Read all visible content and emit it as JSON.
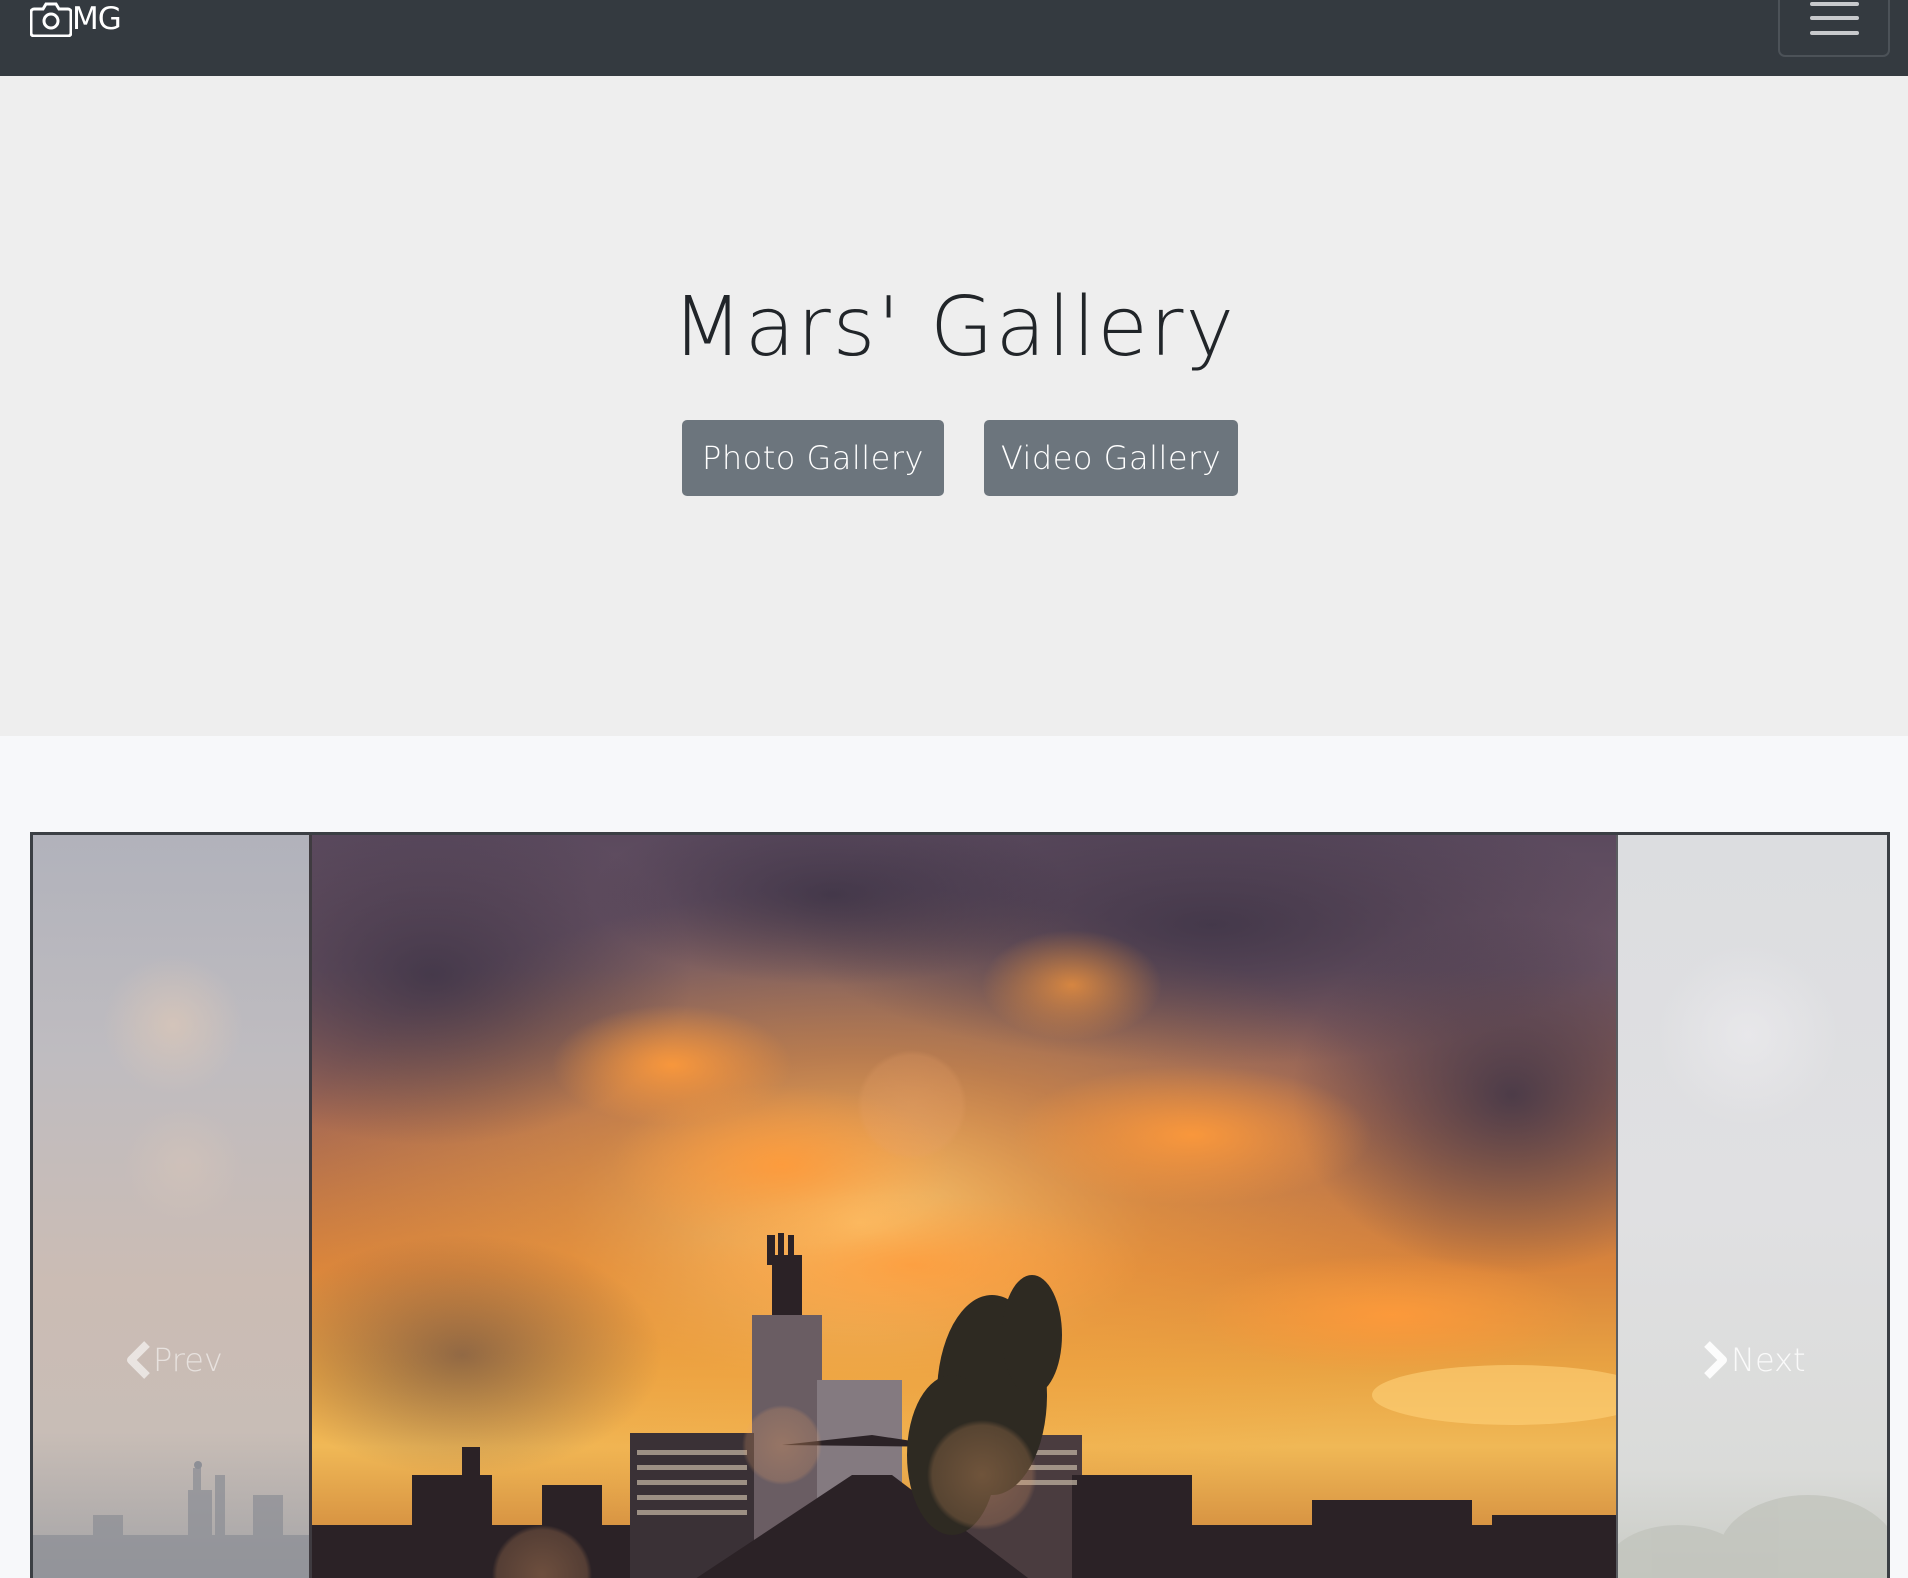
{
  "navbar": {
    "brand_text": "MG",
    "brand_icon": "camera-icon",
    "toggler_icon": "hamburger-menu-icon"
  },
  "hero": {
    "title": "Mars' Gallery",
    "buttons": {
      "photo": "Photo Gallery",
      "video": "Video Gallery"
    }
  },
  "carousel": {
    "prev_label": "Prev",
    "next_label": "Next",
    "prev_icon": "chevron-left-icon",
    "next_icon": "chevron-right-icon"
  },
  "colors": {
    "navbar_bg": "#343a40",
    "hero_bg": "#eeeeee",
    "button_bg": "#6c757d",
    "page_bg": "#f7f8fa"
  }
}
